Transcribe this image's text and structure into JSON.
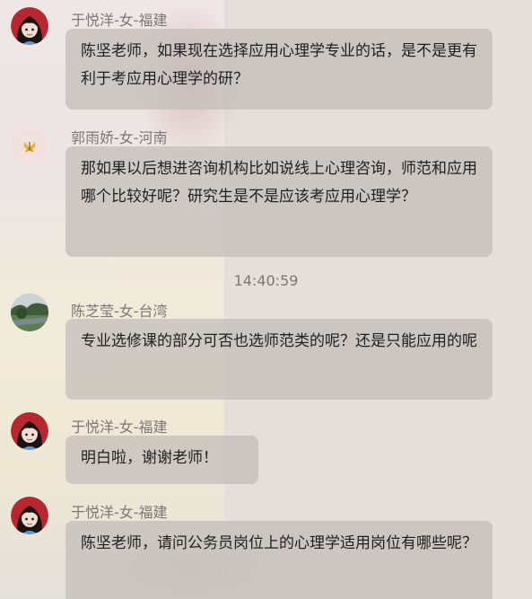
{
  "messages": [
    {
      "sender": "于悦洋-女-福建",
      "text": "陈坚老师，如果现在选择应用心理学专业的话，是不是更有利于考应用心理学的研？"
    },
    {
      "sender": "郭雨娇-女-河南",
      "text": "那如果以后想进咨询机构比如说线上心理咨询，师范和应用哪个比较好呢？研究生是不是应该考应用心理学？"
    },
    {
      "sender": "陈芝莹-女-台湾",
      "text": "专业选修课的部分可否也选师范类的呢？还是只能应用的呢"
    },
    {
      "sender": "于悦洋-女-福建",
      "text": "明白啦，谢谢老师！"
    },
    {
      "sender": "于悦洋-女-福建",
      "text": "陈坚老师，请问公务员岗位上的心理学适用岗位有哪些呢？"
    }
  ],
  "timestamp": "14:40:59",
  "avatars": {
    "a1": "girl-portrait-avatar",
    "a2": "butterfly-avatar",
    "a3": "landscape-photo-avatar"
  },
  "colors": {
    "bubble": "#c4bfbb",
    "sender_text": "#7c7775",
    "message_text": "#1f1f1f"
  }
}
